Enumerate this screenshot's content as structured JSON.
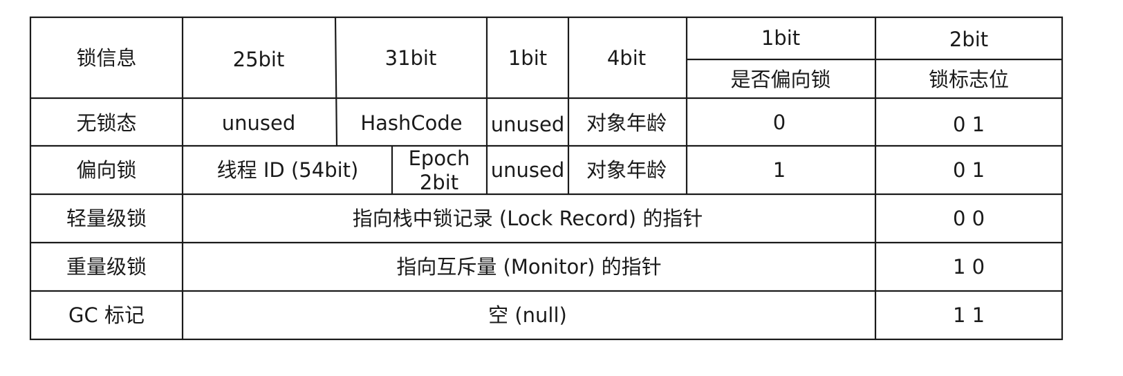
{
  "header": {
    "lock_info": "锁信息",
    "bits_25": "25bit",
    "bits_31": "31bit",
    "bits_1a": "1bit",
    "bits_4": "4bit",
    "bits_1b": "1bit",
    "bits_2": "2bit",
    "biased_flag": "是否偏向锁",
    "lock_flag": "锁标志位"
  },
  "rows": {
    "unlocked": {
      "label": "无锁态",
      "unused_25": "unused",
      "hashcode": "HashCode",
      "unused_1": "unused",
      "age": "对象年龄",
      "biased": "0",
      "flag": "0 1"
    },
    "biased": {
      "label": "偏向锁",
      "thread_id": "线程 ID (54bit)",
      "epoch_line1": "Epoch",
      "epoch_line2": "2bit",
      "unused_1": "unused",
      "age": "对象年龄",
      "biased": "1",
      "flag": "0 1"
    },
    "lightweight": {
      "label": "轻量级锁",
      "content": "指向栈中锁记录 (Lock Record) 的指针",
      "flag": "0 0"
    },
    "heavyweight": {
      "label": "重量级锁",
      "content": "指向互斥量 (Monitor) 的指针",
      "flag": "1 0"
    },
    "gc": {
      "label": "GC 标记",
      "content": "空 (null)",
      "flag": "1 1"
    }
  }
}
